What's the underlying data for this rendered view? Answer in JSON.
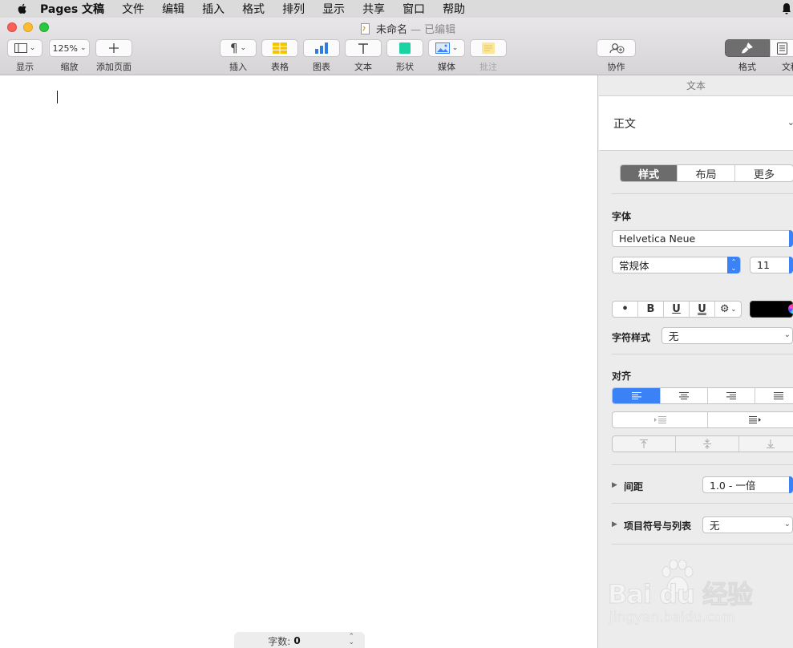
{
  "menubar": {
    "items": [
      "Pages 文稿",
      "文件",
      "编辑",
      "插入",
      "格式",
      "排列",
      "显示",
      "共享",
      "窗口",
      "帮助"
    ]
  },
  "window": {
    "doc_name": "未命名",
    "doc_state": "— 已编辑"
  },
  "toolbar": {
    "view_label": "显示",
    "zoom_value": "125%",
    "zoom_label": "缩放",
    "add_page_label": "添加页面",
    "insert_label": "插入",
    "table_label": "表格",
    "chart_label": "图表",
    "text_label": "文本",
    "shape_label": "形状",
    "media_label": "媒体",
    "comment_label": "批注",
    "collab_label": "协作",
    "format_label": "格式",
    "document_label": "文稿",
    "accent_color": "#3a82f6",
    "table_color": "#f5c400",
    "chart_color": "#2f7de1",
    "shape_color": "#19d3a2"
  },
  "document": {
    "word_count_label": "字数:",
    "word_count_value": "0"
  },
  "inspector": {
    "header": "文本",
    "paragraph_style": "正文",
    "tabs": [
      "样式",
      "布局",
      "更多"
    ],
    "font_section": "字体",
    "font_family": "Helvetica Neue",
    "font_typeface": "常规体",
    "font_size": "11",
    "style_buttons": [
      "•",
      "B",
      "U",
      "U"
    ],
    "char_style_label": "字符样式",
    "char_style_value": "无",
    "align_section": "对齐",
    "spacing_label": "间距",
    "spacing_value": "1.0 - 一倍",
    "bullets_label": "项目符号与列表",
    "bullets_value": "无"
  },
  "watermark": {
    "brand": "Bai du 经验",
    "url": "jingyan.baidu.com"
  }
}
